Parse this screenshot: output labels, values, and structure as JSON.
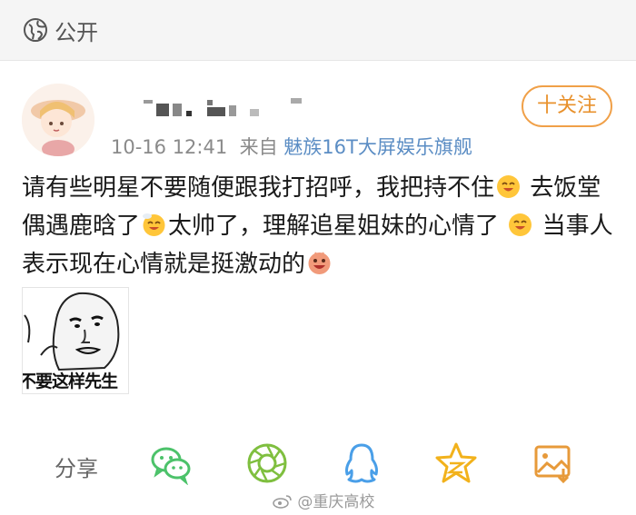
{
  "header": {
    "visibility_label": "公开",
    "icon": "globe-icon"
  },
  "post": {
    "username_display": "（已模糊）",
    "timestamp": "10-16 12:41",
    "from_label": "来自",
    "device": "魅族16T大屏娱乐旗舰",
    "follow_label": "十关注",
    "text_parts": [
      "请有些明星不要随便跟我打招呼，我把持不住",
      "去饭堂偶遇鹿晗了",
      "太帅了，理解追星姐妹的心情了",
      "当事人表示现在心情就是挺激动的"
    ],
    "meme_caption": "不要这样先生"
  },
  "share_bar": {
    "label": "分享",
    "icons": [
      "wechat-icon",
      "moments-icon",
      "qq-icon",
      "qzone-icon",
      "save-image-icon"
    ]
  },
  "watermark": {
    "text": "@重庆高校"
  },
  "colors": {
    "accent": "#e8912c",
    "link": "#5b8dc4",
    "wechat": "#4cc26a",
    "moments": "#7fbf3f",
    "qq": "#4a9fe8",
    "qzone": "#f2b21c"
  }
}
